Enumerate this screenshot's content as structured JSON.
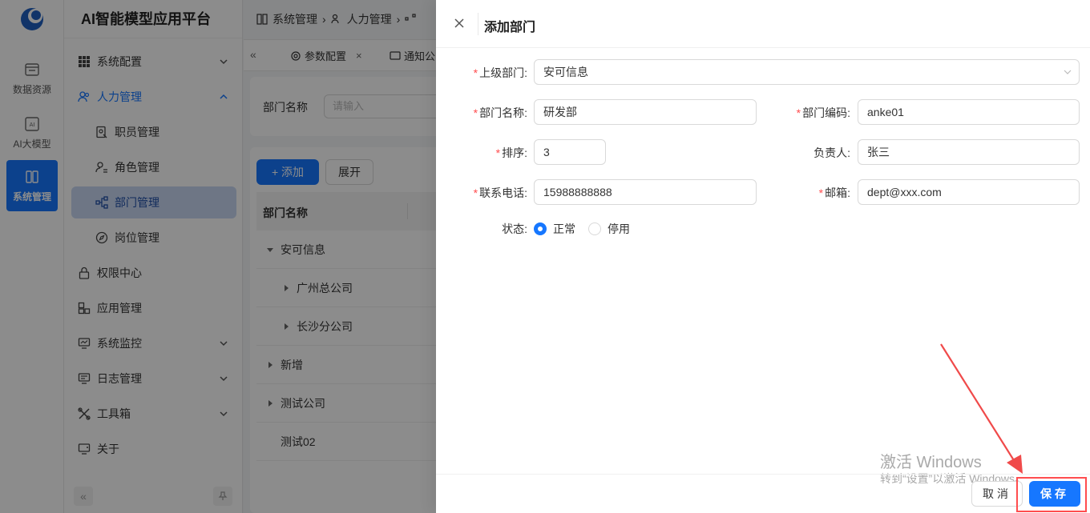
{
  "rail": {
    "items": [
      {
        "label": "数据资源",
        "icon": "data-resource-icon"
      },
      {
        "label": "AI大模型",
        "icon": "ai-model-icon"
      },
      {
        "label": "系统管理",
        "icon": "system-icon"
      }
    ]
  },
  "sidebar": {
    "title": "AI智能模型应用平台",
    "items": [
      {
        "label": "系统配置",
        "icon": "grid-icon"
      },
      {
        "label": "人力管理",
        "icon": "people-icon"
      },
      {
        "label": "职员管理",
        "icon": "staff-icon"
      },
      {
        "label": "角色管理",
        "icon": "role-icon"
      },
      {
        "label": "部门管理",
        "icon": "org-icon"
      },
      {
        "label": "岗位管理",
        "icon": "compass-icon"
      },
      {
        "label": "权限中心",
        "icon": "lock-icon"
      },
      {
        "label": "应用管理",
        "icon": "app-icon"
      },
      {
        "label": "系统监控",
        "icon": "monitor-icon"
      },
      {
        "label": "日志管理",
        "icon": "log-icon"
      },
      {
        "label": "工具箱",
        "icon": "tools-icon"
      },
      {
        "label": "关于",
        "icon": "about-icon"
      }
    ]
  },
  "breadcrumb": [
    "系统管理",
    "人力管理"
  ],
  "tabs": [
    "参数配置",
    "通知公"
  ],
  "search": {
    "label": "部门名称",
    "placeholder": "请输入"
  },
  "toolbar": {
    "add_label": "+ 添加",
    "expand_label": "展开"
  },
  "table": {
    "header": "部门名称",
    "rows": [
      {
        "name": "安可信息",
        "level": 0,
        "expanded": true
      },
      {
        "name": "广州总公司",
        "level": 1,
        "expanded": false
      },
      {
        "name": "长沙分公司",
        "level": 1,
        "expanded": false
      },
      {
        "name": "新增",
        "level": 0,
        "expanded": false
      },
      {
        "name": "测试公司",
        "level": 0,
        "expanded": false
      },
      {
        "name": "测试02",
        "level": 0,
        "expanded": null
      }
    ]
  },
  "drawer": {
    "title": "添加部门",
    "fields": {
      "parent": {
        "label": "上级部门:",
        "value": "安可信息"
      },
      "name": {
        "label": "部门名称:",
        "value": "研发部"
      },
      "code": {
        "label": "部门编码:",
        "value": "anke01"
      },
      "sort": {
        "label": "排序:",
        "value": "3"
      },
      "leader": {
        "label": "负责人:",
        "value": "张三"
      },
      "phone": {
        "label": "联系电话:",
        "value": "15988888888"
      },
      "email": {
        "label": "邮箱:",
        "value": "dept@xxx.com"
      },
      "status": {
        "label": "状态:",
        "options": [
          "正常",
          "停用"
        ],
        "selected": "正常"
      }
    },
    "cancel_label": "取消",
    "save_label": "保存"
  },
  "watermark": {
    "line1": "激活 Windows",
    "line2": "转到“设置”以激活 Windows。"
  },
  "colors": {
    "primary": "#1677ff",
    "required": "#ff4d4f",
    "highlight": "#ff4d4f"
  }
}
